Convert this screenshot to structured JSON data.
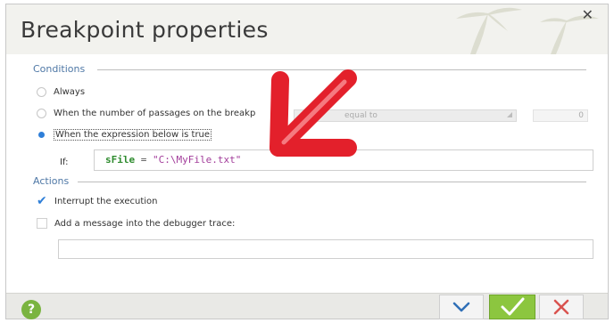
{
  "dialog": {
    "title": "Breakpoint properties",
    "close_label": "✕"
  },
  "conditions": {
    "header": "Conditions",
    "options": [
      {
        "label": "Always",
        "selected": false
      },
      {
        "label": "When the number of passages on the breakp",
        "selected": false
      },
      {
        "label": "When the expression below is true",
        "selected": true
      }
    ],
    "passages_combo_value": "equal to",
    "passages_count": "0",
    "if_label": "If:",
    "expression": {
      "variable": "sFile",
      "operator": " = ",
      "value": "\"C:\\MyFile.txt\""
    }
  },
  "actions": {
    "header": "Actions",
    "items": [
      {
        "label": "Interrupt the execution",
        "checked": true
      },
      {
        "label": "Add a message into the debugger trace:",
        "checked": false
      }
    ],
    "message_value": ""
  },
  "footer": {
    "help_label": "?"
  },
  "colors": {
    "accent_blue": "#2f7fd8",
    "ok_green": "#8cc63f",
    "cancel_red": "#d9534f",
    "arrow_red": "#e3202b"
  }
}
